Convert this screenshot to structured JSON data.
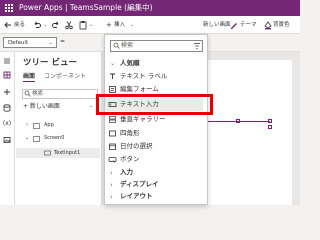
{
  "titlebar": {
    "title": "Power Apps  |  TeamsSample (編集中)"
  },
  "toolbar": {
    "back": "戻る",
    "insert": "挿入",
    "new_screen": "新しい画面",
    "theme": "テーマ",
    "background": "背景色"
  },
  "formula": {
    "property": "Default"
  },
  "tree": {
    "title": "ツリー ビュー",
    "tabs": [
      "画面",
      "コンポーネント"
    ],
    "search_placeholder": "検索",
    "new_screen": "+ 新しい画面",
    "nodes": {
      "app": "App",
      "screen": "Screen0",
      "control": "TextInput1"
    }
  },
  "insert_menu": {
    "search_placeholder": "検索",
    "section_popular": "人気順",
    "items": [
      "テキスト ラベル",
      "編集フォーム",
      "テキスト入力",
      "垂直ギャラリー",
      "四角形",
      "日付の選択",
      "ボタン"
    ],
    "groups": [
      "入力",
      "ディスプレイ",
      "レイアウト"
    ]
  },
  "colors": {
    "brand": "#742774",
    "highlight": "#e00000"
  }
}
